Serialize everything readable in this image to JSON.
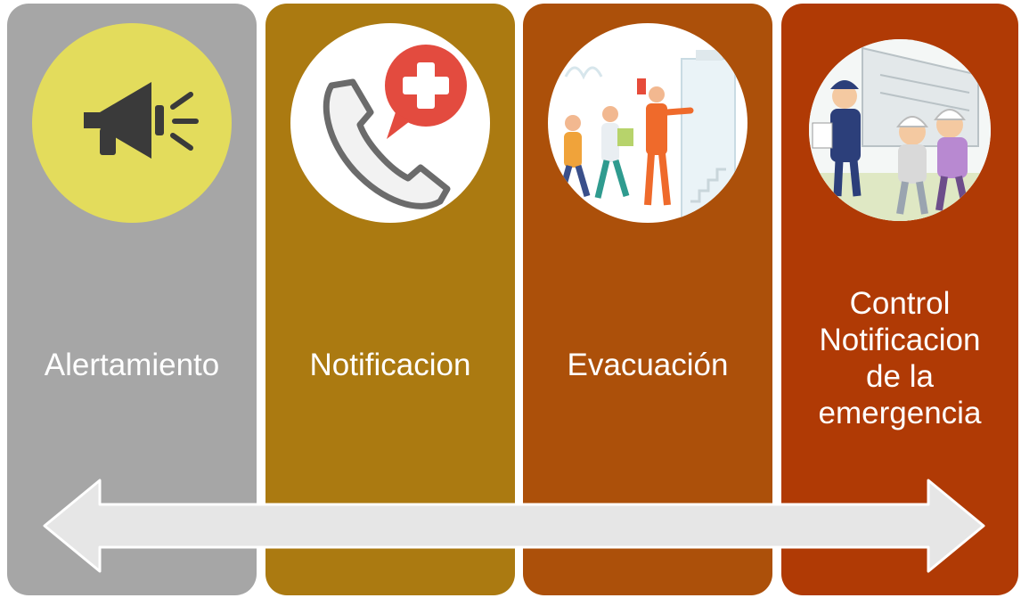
{
  "colors": {
    "panel_1": "#a6a6a6",
    "panel_2": "#ab7a11",
    "panel_3": "#ac500a",
    "panel_4": "#b03a05",
    "arrow_fill": "#e6e6e6",
    "arrow_stroke": "#ffffff"
  },
  "steps": [
    {
      "label": "Alertamiento",
      "icon": "megaphone-icon"
    },
    {
      "label": "Notificacion",
      "icon": "emergency-phone-icon"
    },
    {
      "label": "Evacuación",
      "icon": "evacuation-illustration"
    },
    {
      "label_lines": [
        "Control",
        "Notificacion",
        "de la",
        "emergencia"
      ],
      "icon": "guided-evacuation-illustration"
    }
  ],
  "arrow": {
    "direction": "bidirectional"
  }
}
